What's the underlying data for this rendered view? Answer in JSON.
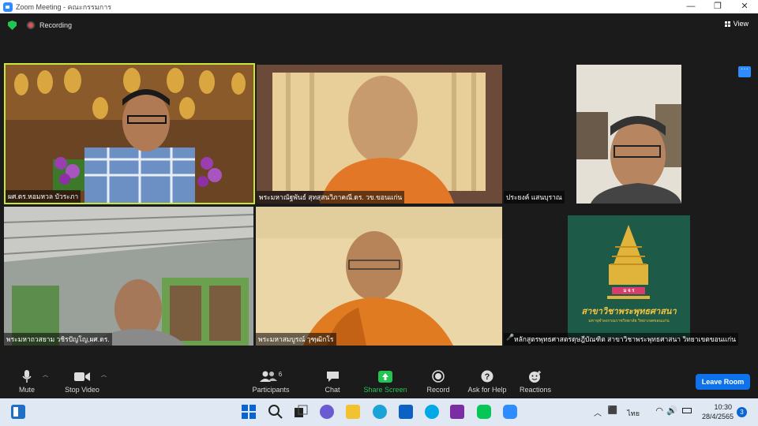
{
  "window": {
    "title": "Zoom Meeting - คณะกรรมการ",
    "minimize": "—",
    "restore": "❐",
    "close": "✕"
  },
  "topbar": {
    "recording_label": "Recording",
    "view_label": "View"
  },
  "participants": [
    {
      "name": "ผศ.ดร.หอมหวล บัวระภา",
      "active": true
    },
    {
      "name": "พระมหาณัฐพันธ์ สุทสฺสนวิภาคณี.ดร. วข.ขอนแก่น"
    },
    {
      "name": "ประยงค์ แสนบุราณ"
    },
    {
      "name": "พระมหาถวสยาม วชิรปัญโญ,ผศ.ดร."
    },
    {
      "name": "พระมหาสมบูรณ์ วุฑฺฒิกโร"
    },
    {
      "name": "หลักสูตรพุทธศาสตรดุษฎีบัณฑิต สาขาวิชาพระพุทธศาสนา วิทยาเขตขอนแก่น"
    }
  ],
  "logo": {
    "monogram": "ม จ ร",
    "caption": "สาขาวิชาพระพุทธศาสนา",
    "subcaption": "มหาจุฬาลงกรณราชวิทยาลัย วิทยาเขตขอนแก่น"
  },
  "toolbar": {
    "mute": "Mute",
    "stop_video": "Stop Video",
    "participants": "Participants",
    "participants_count": "6",
    "chat": "Chat",
    "share_screen": "Share Screen",
    "record": "Record",
    "ask_for_help": "Ask for Help",
    "reactions": "Reactions",
    "leave_room": "Leave Room"
  },
  "taskbar": {
    "language": "ไทย",
    "time": "10:30",
    "date": "28/4/2565",
    "notification_count": "3"
  },
  "colors": {
    "accent": "#2d8cff",
    "share_green": "#23c552",
    "leave_blue": "#0e72ed",
    "active_speaker": "#c8e63c"
  }
}
